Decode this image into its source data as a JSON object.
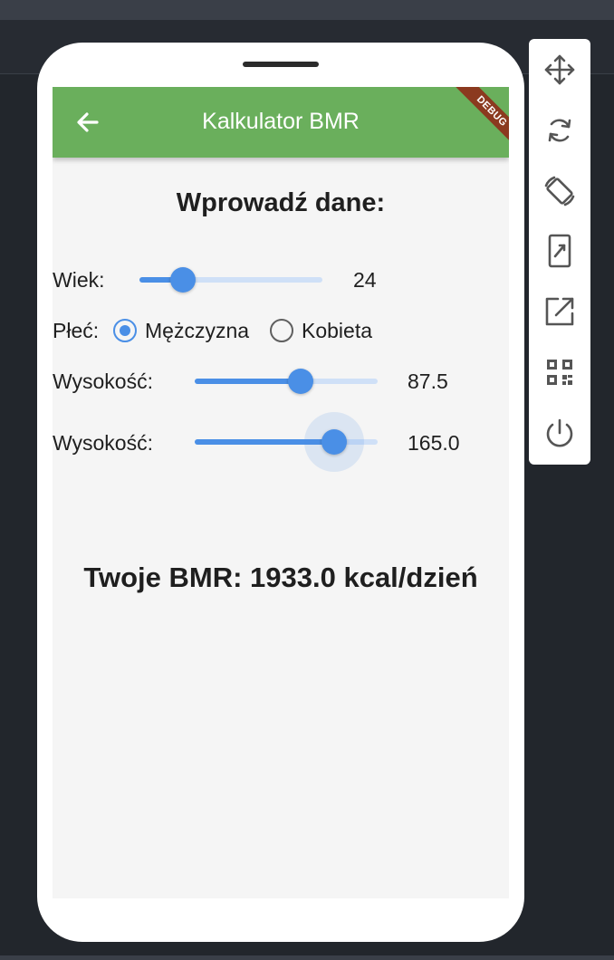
{
  "app_bar": {
    "title": "Kalkulator BMR",
    "debug_label": "DEBUG"
  },
  "form": {
    "heading": "Wprowadź dane:",
    "age": {
      "label": "Wiek:",
      "value": "24",
      "fraction": 0.24
    },
    "gender": {
      "label": "Płeć:",
      "options": [
        {
          "label": "Mężczyzna",
          "selected": true
        },
        {
          "label": "Kobieta",
          "selected": false
        }
      ]
    },
    "weight": {
      "label": "Wysokość:",
      "value": "87.5",
      "fraction": 0.58
    },
    "height": {
      "label": "Wysokość:",
      "value": "165.0",
      "fraction": 0.76
    }
  },
  "result": {
    "text": "Twoje BMR: 1933.0 kcal/dzień"
  },
  "toolbar": {
    "tools": [
      "move-icon",
      "rotate-icon",
      "rotate-device-icon",
      "resize-device-icon",
      "open-external-icon",
      "qr-code-icon",
      "power-icon"
    ]
  },
  "colors": {
    "app_bar": "#6aaf5c",
    "accent": "#4a8fe6",
    "track": "#cfe0f7",
    "screen_bg": "#f5f5f5",
    "debug_banner": "#8b3a1f"
  }
}
